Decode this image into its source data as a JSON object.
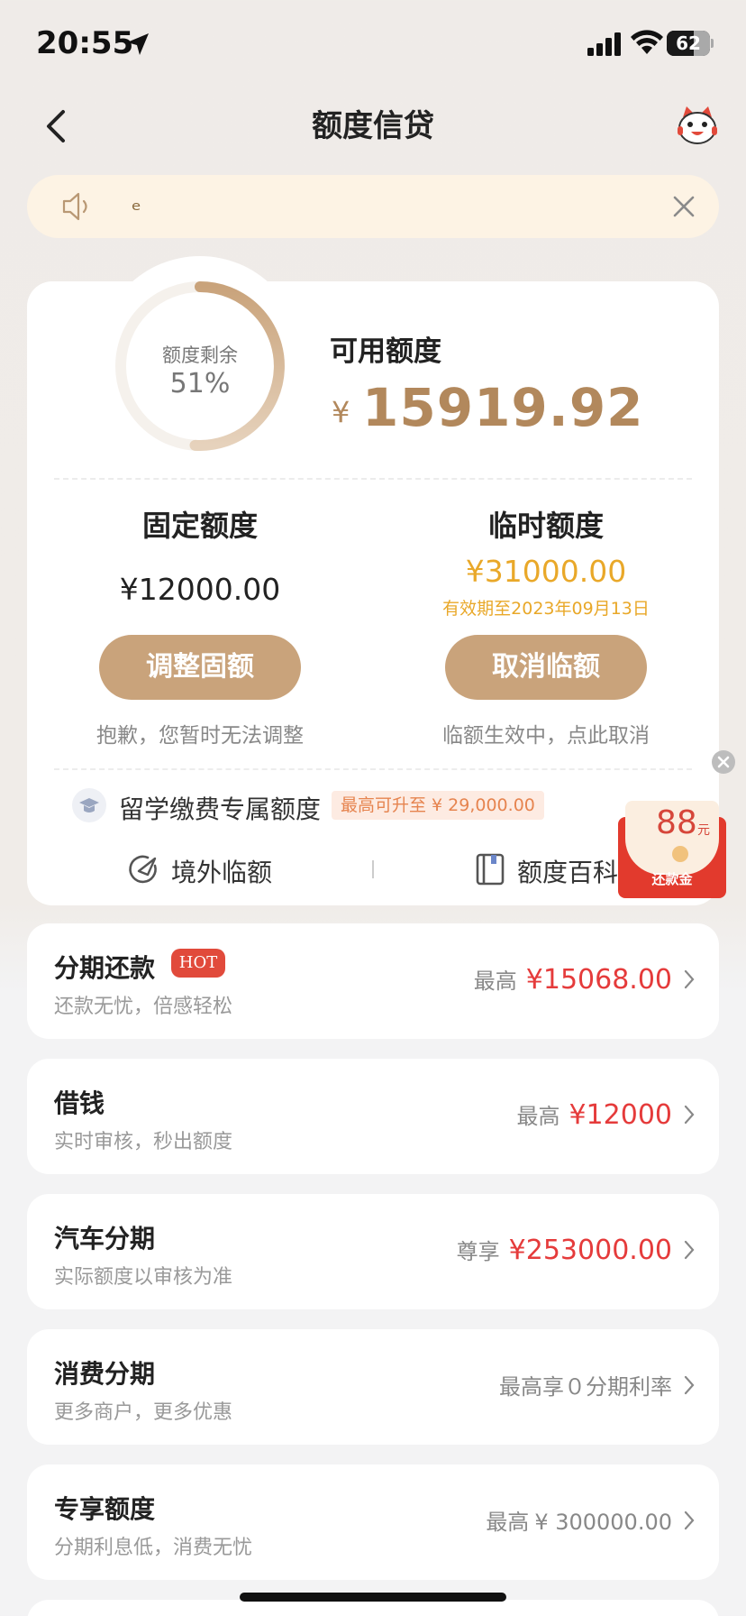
{
  "status_bar": {
    "time": "20:55",
    "battery": "62",
    "battery_level": 0.62
  },
  "nav": {
    "title": "额度信贷"
  },
  "notice": {
    "text": "ₑ"
  },
  "quota": {
    "ring_label": "额度剩余",
    "ring_percent": "51%",
    "ring_fraction": 0.51,
    "available_label": "可用额度",
    "available_currency": "¥",
    "available_amount": "15919.92",
    "fixed": {
      "title": "固定额度",
      "amount": "¥12000.00",
      "button": "调整固额",
      "note": "抱歉，您暂时无法调整"
    },
    "temp": {
      "title": "临时额度",
      "amount": "¥31000.00",
      "valid": "有效期至2023年09月13日",
      "button": "取消临额",
      "note": "临额生效中，点此取消"
    },
    "study": {
      "label": "留学缴费专属额度",
      "badge": "最高可升至 ¥ 29,000.00"
    },
    "links": {
      "abroad": "境外临额",
      "wiki": "额度百科"
    }
  },
  "red_packet": {
    "amount": "88",
    "unit": "元",
    "label": "还款金"
  },
  "list": [
    {
      "title": "分期还款",
      "badge": "HOT",
      "subtitle": "还款无忧，倍感轻松",
      "prefix": "最高",
      "amount": "¥15068.00"
    },
    {
      "title": "借钱",
      "subtitle": "实时审核，秒出额度",
      "prefix": "最高",
      "amount": "¥12000"
    },
    {
      "title": "汽车分期",
      "subtitle": "实际额度以审核为准",
      "prefix": "尊享",
      "amount": "¥253000.00"
    },
    {
      "title": "消费分期",
      "subtitle": "更多商户，更多优惠",
      "prefix": "最高享０分期利率",
      "amount": ""
    },
    {
      "title": "专享额度",
      "subtitle": "分期利息低，消费无忧",
      "prefix": "最高",
      "amount": "¥ 300000.00"
    }
  ],
  "colors": {
    "accent_gold": "#c9a37b",
    "amount_gold": "#b2885c",
    "temp_orange": "#e9a829",
    "red": "#e53b3b"
  }
}
